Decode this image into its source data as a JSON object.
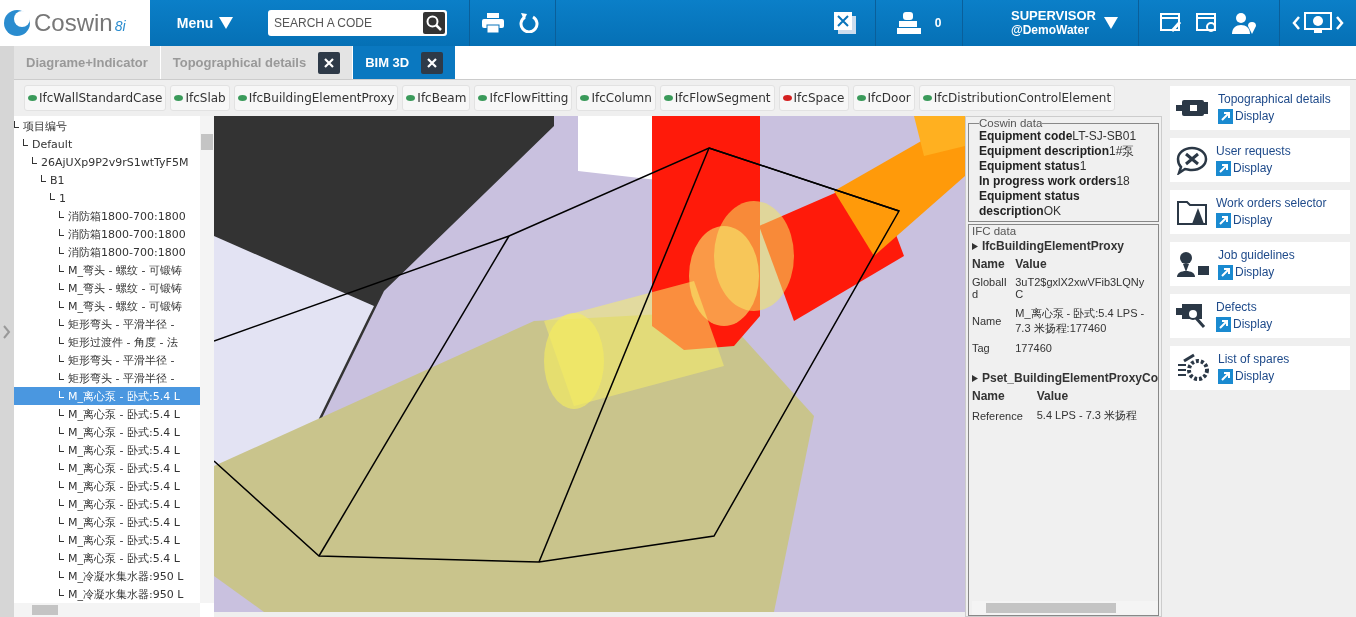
{
  "header": {
    "logo_text": "Coswin",
    "logo_version": "8i",
    "menu": {
      "label": "Menu"
    },
    "search": {
      "placeholder": "SEARCH A CODE"
    },
    "stamp_count": "0",
    "user": {
      "name": "SUPERVISOR",
      "domain": "@DemoWater"
    }
  },
  "tabs": [
    {
      "label": "Diagrame+Indicator",
      "selected": false,
      "closable": false
    },
    {
      "label": "Topographical details",
      "selected": false,
      "closable": true
    },
    {
      "label": "BIM 3D",
      "selected": true,
      "closable": true
    }
  ],
  "filters": [
    {
      "label": "IfcWallStandardCase",
      "color": "#3a9a5a"
    },
    {
      "label": "IfcSlab",
      "color": "#3a9a5a"
    },
    {
      "label": "IfcBuildingElementProxy",
      "color": "#3a9a5a"
    },
    {
      "label": "IfcBeam",
      "color": "#3a9a5a"
    },
    {
      "label": "IfcFlowFitting",
      "color": "#3a9a5a"
    },
    {
      "label": "IfcColumn",
      "color": "#3a9a5a"
    },
    {
      "label": "IfcFlowSegment",
      "color": "#3a9a5a"
    },
    {
      "label": "IfcSpace",
      "color": "#d42020"
    },
    {
      "label": "IfcDoor",
      "color": "#3a9a5a"
    },
    {
      "label": "IfcDistributionControlElement",
      "color": "#3a9a5a"
    }
  ],
  "tree": [
    {
      "label": "项目编号",
      "selected": false,
      "children": [
        {
          "label": "Default",
          "selected": false,
          "children": [
            {
              "label": "26AjUXp9P2v9rS1wtTyF5M",
              "selected": false,
              "children": [
                {
                  "label": "B1",
                  "selected": false,
                  "children": [
                    {
                      "label": "1",
                      "selected": false,
                      "children": [
                        {
                          "label": "消防箱1800-700:1800",
                          "selected": false
                        },
                        {
                          "label": "消防箱1800-700:1800",
                          "selected": false
                        },
                        {
                          "label": "消防箱1800-700:1800",
                          "selected": false
                        },
                        {
                          "label": "M_弯头 - 螺纹 - 可锻铸",
                          "selected": false
                        },
                        {
                          "label": "M_弯头 - 螺纹 - 可锻铸",
                          "selected": false
                        },
                        {
                          "label": "M_弯头 - 螺纹 - 可锻铸",
                          "selected": false
                        },
                        {
                          "label": "矩形弯头 - 平滑半径 -",
                          "selected": false
                        },
                        {
                          "label": "矩形过渡件 - 角度 - 法",
                          "selected": false
                        },
                        {
                          "label": "矩形弯头 - 平滑半径 -",
                          "selected": false
                        },
                        {
                          "label": "矩形弯头 - 平滑半径 -",
                          "selected": false
                        },
                        {
                          "label": "M_离心泵 - 卧式:5.4 L",
                          "selected": true
                        },
                        {
                          "label": "M_离心泵 - 卧式:5.4 L",
                          "selected": false
                        },
                        {
                          "label": "M_离心泵 - 卧式:5.4 L",
                          "selected": false
                        },
                        {
                          "label": "M_离心泵 - 卧式:5.4 L",
                          "selected": false
                        },
                        {
                          "label": "M_离心泵 - 卧式:5.4 L",
                          "selected": false
                        },
                        {
                          "label": "M_离心泵 - 卧式:5.4 L",
                          "selected": false
                        },
                        {
                          "label": "M_离心泵 - 卧式:5.4 L",
                          "selected": false
                        },
                        {
                          "label": "M_离心泵 - 卧式:5.4 L",
                          "selected": false
                        },
                        {
                          "label": "M_离心泵 - 卧式:5.4 L",
                          "selected": false
                        },
                        {
                          "label": "M_离心泵 - 卧式:5.4 L",
                          "selected": false
                        },
                        {
                          "label": "M_冷凝水集水器:950 L",
                          "selected": false
                        },
                        {
                          "label": "M_冷凝水集水器:950 L",
                          "selected": false
                        }
                      ]
                    }
                  ]
                }
              ]
            }
          ]
        }
      ]
    }
  ],
  "coswin_data": {
    "title": "Coswin data",
    "rows": [
      {
        "label": "Equipment code",
        "value": "LT-SJ-SB01"
      },
      {
        "label": "Equipment description",
        "value": "1#泵"
      },
      {
        "label": "Equipment status",
        "value": "1"
      },
      {
        "label": "In progress work orders",
        "value": "18"
      },
      {
        "label": "Equipment status description",
        "value": "OK"
      }
    ]
  },
  "ifc_data": {
    "title": "IFC data",
    "sections": [
      {
        "title": "IfcBuildingElementProxy",
        "columns": [
          "Name",
          "Value"
        ],
        "rows": [
          {
            "name": "GlobalId",
            "value": "3uT2$gxlX2xwVFib3LQNyC"
          },
          {
            "name": "Name",
            "value": "M_离心泵 - 卧式:5.4 LPS - 7.3 米扬程:177460"
          },
          {
            "name": "Tag",
            "value": "177460"
          }
        ]
      },
      {
        "title": "Pset_BuildingElementProxyCo",
        "columns": [
          "Name",
          "Value"
        ],
        "rows": [
          {
            "name": "Reference",
            "value": "5.4 LPS - 7.3 米扬程"
          }
        ]
      }
    ]
  },
  "shortcuts": [
    {
      "title": "Topographical details",
      "link": "Display"
    },
    {
      "title": "User requests",
      "link": "Display"
    },
    {
      "title": "Work orders selector",
      "link": "Display"
    },
    {
      "title": "Job guidelines",
      "link": "Display"
    },
    {
      "title": "Defects",
      "link": "Display"
    },
    {
      "title": "List of spares",
      "link": "Display"
    }
  ]
}
